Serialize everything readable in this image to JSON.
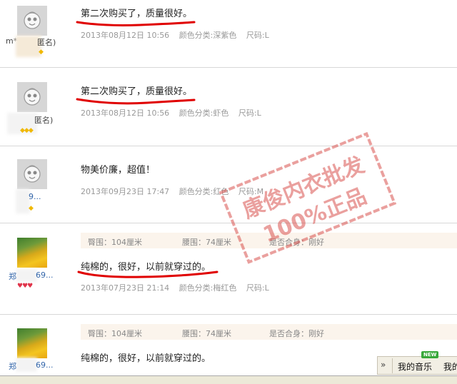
{
  "reviews": [
    {
      "user": "m*",
      "user_suffix": "匿名)",
      "rank": "◆",
      "content": "第二次购买了，质量很好。",
      "date": "2013年08月12日 10:56",
      "color_label": "颜色分类:深紫色",
      "size_label": "尺码:L"
    },
    {
      "user": "",
      "user_suffix": "匿名)",
      "rank": "◆◆◆",
      "content": "第二次购买了，质量很好。",
      "date": "2013年08月12日 10:56",
      "color_label": "颜色分类:虾色",
      "size_label": "尺码:L"
    },
    {
      "user": "9...",
      "rank": "◆",
      "content": "物美价廉，超值！",
      "date": "2013年09月23日 17:47",
      "color_label": "颜色分类:红色",
      "size_label": "尺码:M"
    },
    {
      "user": "郑",
      "user_suffix": "69...",
      "hearts": "♥♥♥",
      "attrs": {
        "bust": "臀围：104厘米",
        "waist": "腰围：74厘米",
        "fit": "是否合身：刚好"
      },
      "content": "纯棉的，很好，以前就穿过的。",
      "date": "2013年07月23日 21:14",
      "color_label": "颜色分类:梅红色",
      "size_label": "尺码:L"
    },
    {
      "user": "郑",
      "user_suffix": "69...",
      "attrs": {
        "bust": "臀围：104厘米",
        "waist": "腰围：74厘米",
        "fit": "是否合身：刚好"
      },
      "content": "纯棉的，很好，以前就穿过的。"
    }
  ],
  "watermark": {
    "line1": "康俊内衣批发",
    "line2": "100%正品",
    "color": "#d9534f"
  },
  "music_widget": {
    "arrows": "»",
    "label": "我的音乐",
    "extra": "我的",
    "new_badge": "NEW"
  },
  "colors": {
    "accent_underline": "#e00000",
    "attr_bg": "#fbf4ec"
  }
}
